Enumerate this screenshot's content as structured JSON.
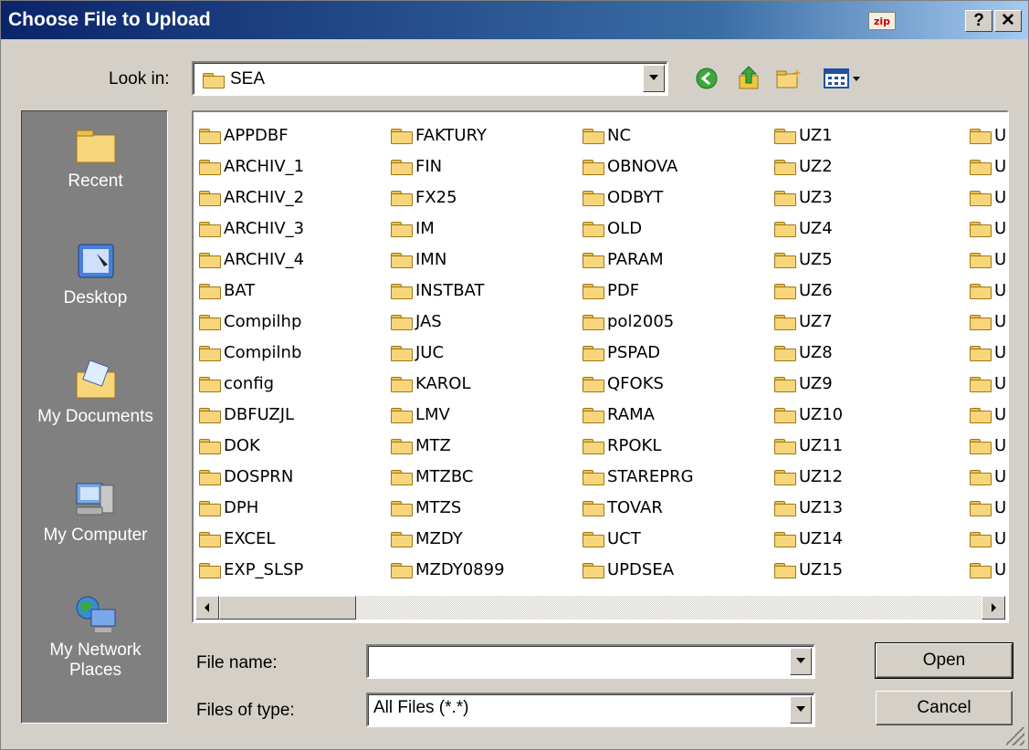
{
  "window": {
    "title": "Choose File to Upload",
    "zip_label": "zip",
    "help_label": "?",
    "close_label": "✕"
  },
  "lookin": {
    "label": "Look in:",
    "value": "SEA"
  },
  "places": [
    {
      "label": "Recent",
      "icon": "recent-folder-icon"
    },
    {
      "label": "Desktop",
      "icon": "desktop-icon"
    },
    {
      "label": "My Documents",
      "icon": "my-documents-icon"
    },
    {
      "label": "My Computer",
      "icon": "my-computer-icon"
    },
    {
      "label": "My Network\nPlaces",
      "icon": "network-places-icon"
    }
  ],
  "files": {
    "col1": [
      "APPDBF",
      "ARCHIV_1",
      "ARCHIV_2",
      "ARCHIV_3",
      "ARCHIV_4",
      "BAT",
      "Compilhp",
      "Compilnb",
      "config",
      "DBFUZJL",
      "DOK",
      "DOSPRN",
      "DPH",
      "EXCEL",
      "EXP_SLSP"
    ],
    "col2": [
      "FAKTURY",
      "FIN",
      "FX25",
      "IM",
      "IMN",
      "INSTBAT",
      "JAS",
      "JUC",
      "KAROL",
      "LMV",
      "MTZ",
      "MTZBC",
      "MTZS",
      "MZDY",
      "MZDY0899"
    ],
    "col3": [
      "NC",
      "OBNOVA",
      "ODBYT",
      "OLD",
      "PARAM",
      "PDF",
      "pol2005",
      "PSPAD",
      "QFOKS",
      "RAMA",
      "RPOKL",
      "STAREPRG",
      "TOVAR",
      "UCT",
      "UPDSEA"
    ],
    "col4": [
      "UZ1",
      "UZ2",
      "UZ3",
      "UZ4",
      "UZ5",
      "UZ6",
      "UZ7",
      "UZ8",
      "UZ9",
      "UZ10",
      "UZ11",
      "UZ12",
      "UZ13",
      "UZ14",
      "UZ15"
    ],
    "col5": [
      "U",
      "U",
      "U",
      "U",
      "U",
      "U",
      "U",
      "U",
      "U",
      "U",
      "U",
      "U",
      "U",
      "U",
      "U"
    ]
  },
  "filename": {
    "label": "File name:",
    "value": ""
  },
  "filetype": {
    "label": "Files of type:",
    "value": "All Files (*.*)"
  },
  "buttons": {
    "open": "Open",
    "cancel": "Cancel"
  }
}
